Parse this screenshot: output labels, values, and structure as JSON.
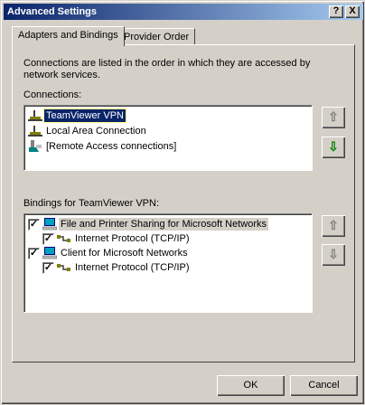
{
  "window": {
    "title": "Advanced Settings",
    "help_glyph": "?",
    "close_glyph": "X"
  },
  "tabs": [
    {
      "label": "Adapters and Bindings",
      "active": true
    },
    {
      "label": "Provider Order",
      "active": false
    }
  ],
  "description": "Connections are listed in the order in which they are accessed by network services.",
  "connections": {
    "label": "Connections:",
    "items": [
      {
        "label": "TeamViewer VPN",
        "icon": "network-adapter-icon",
        "selected": true
      },
      {
        "label": "Local Area Connection",
        "icon": "network-adapter-icon",
        "selected": false
      },
      {
        "label": "[Remote Access connections]",
        "icon": "remote-access-icon",
        "selected": false
      }
    ],
    "up_glyph": "⇧",
    "down_glyph": "⇩"
  },
  "bindings": {
    "label": "Bindings for TeamViewer VPN:",
    "items": [
      {
        "label": "File and Printer Sharing for Microsoft Networks",
        "checked": true,
        "level": 0,
        "icon": "computer-share-icon"
      },
      {
        "label": "Internet Protocol (TCP/IP)",
        "checked": true,
        "level": 1,
        "icon": "protocol-icon"
      },
      {
        "label": "Client for Microsoft Networks",
        "checked": true,
        "level": 0,
        "icon": "computer-client-icon"
      },
      {
        "label": "Internet Protocol (TCP/IP)",
        "checked": true,
        "level": 1,
        "icon": "protocol-icon"
      }
    ],
    "up_glyph": "⇧",
    "down_glyph": "⇩"
  },
  "buttons": {
    "ok": "OK",
    "cancel": "Cancel"
  },
  "colors": {
    "title_start": "#0a246a",
    "title_end": "#a6caf0",
    "selection": "#0a246a",
    "face": "#d4d0c8",
    "arrow_green": "#008000"
  }
}
